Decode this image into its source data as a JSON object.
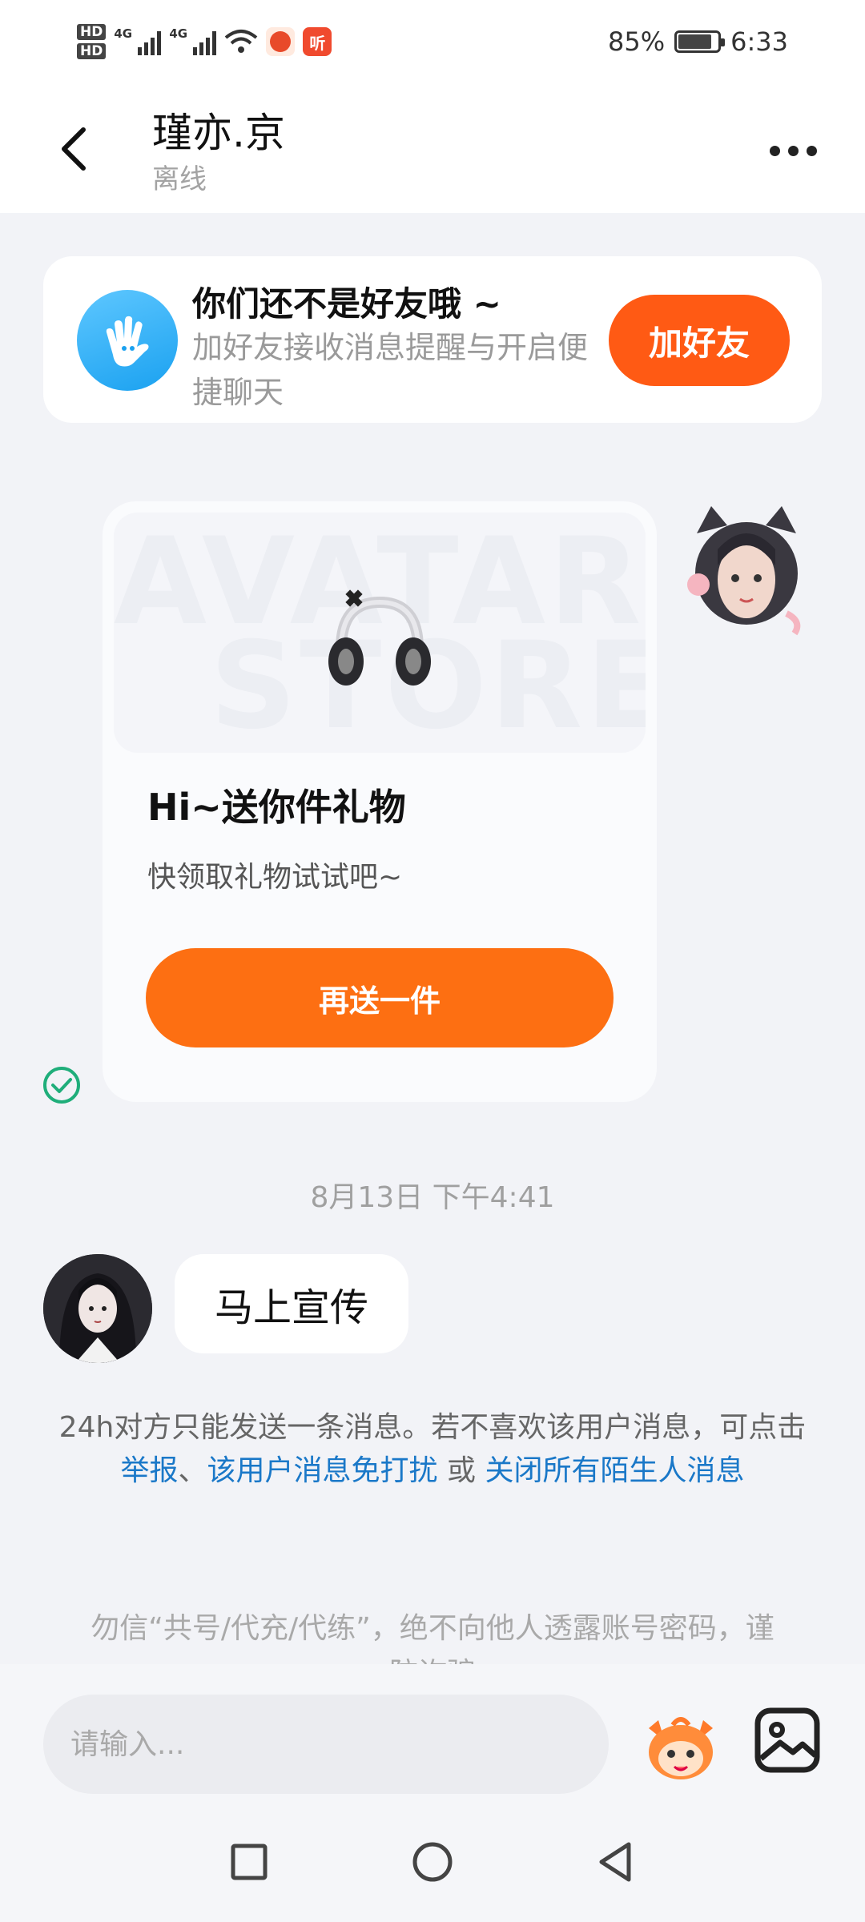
{
  "status_bar": {
    "hd1": "HD",
    "hd2": "HD",
    "net1": "4G",
    "net2": "4G",
    "app2_label": "听",
    "battery": "85%",
    "time": "6:33"
  },
  "header": {
    "title": "瑾亦.京",
    "status": "离线"
  },
  "friend_banner": {
    "title": "你们还不是好友哦 ~",
    "description": "加好友接收消息提醒与开启便捷聊天",
    "button": "加好友"
  },
  "gift_card": {
    "watermark_line1": "AVATAR",
    "watermark_line2": "STORE",
    "title": "Hi~送你件礼物",
    "subtitle": "快领取礼物试试吧~",
    "button": "再送一件"
  },
  "timestamp": "8月13日 下午4:41",
  "incoming_message": "马上宣传",
  "notice": {
    "text": "24h对方只能发送一条消息。若不喜欢该用户消息，可点击 ",
    "link_report": "举报",
    "sep": "、",
    "link_mute": "该用户消息免打扰",
    "or": " 或 ",
    "link_close": "关闭所有陌生人消息"
  },
  "warning": "勿信“共号/代充/代练”，绝不向他人透露账号密码，谨防诈骗",
  "input": {
    "placeholder": "请输入..."
  },
  "colors": {
    "accent": "#ff5a14",
    "gift_button": "#fd6f12",
    "link": "#1a78c8",
    "check": "#1fae7a"
  }
}
